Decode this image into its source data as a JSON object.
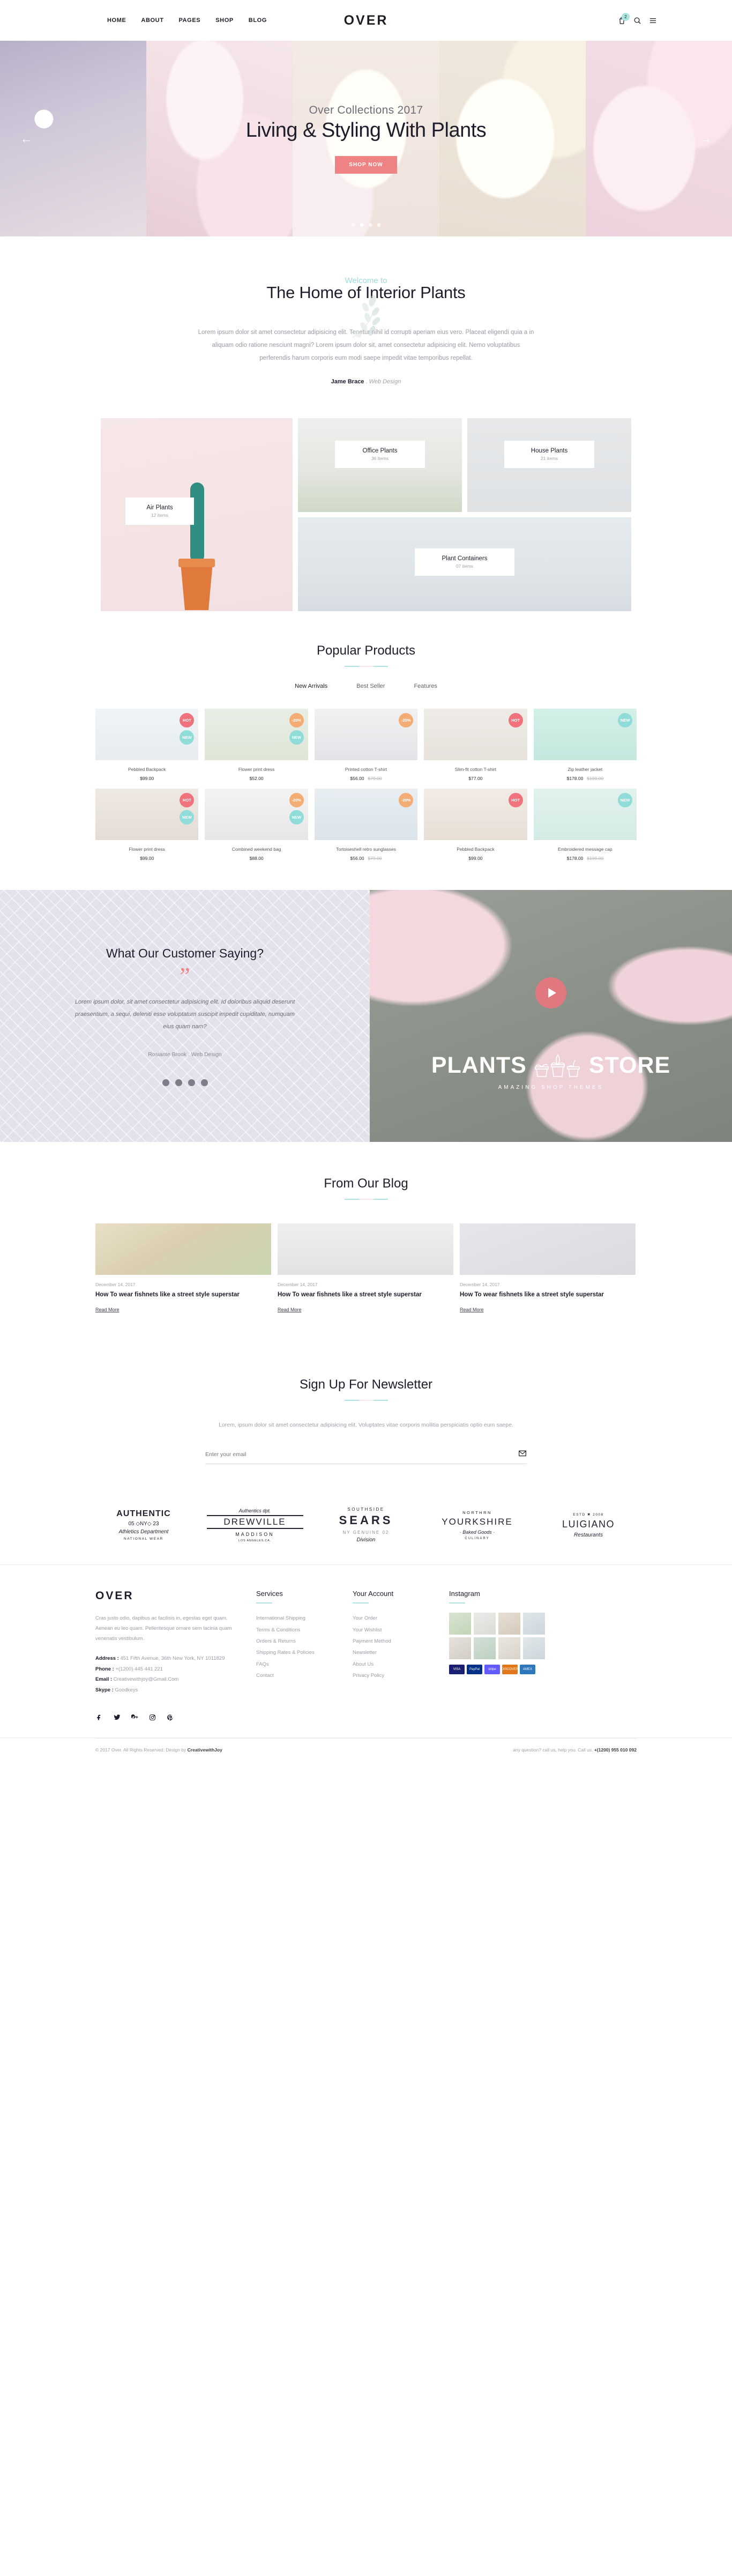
{
  "header": {
    "nav": [
      {
        "label": "HOME"
      },
      {
        "label": "ABOUT"
      },
      {
        "label": "PAGES"
      },
      {
        "label": "SHOP"
      },
      {
        "label": "BLOG"
      }
    ],
    "logo": "OVER",
    "cart_count": "2"
  },
  "hero": {
    "subtitle": "Over Collections 2017",
    "title": "Living & Styling With Plants",
    "cta": "SHOP NOW",
    "prev": "←",
    "next": "→",
    "slides": 4,
    "active_slide": 2
  },
  "intro": {
    "welcome": "Welcome to",
    "title": "The Home of Interior Plants",
    "paragraph": "Lorem ipsum dolor sit amet consectetur adipisicing elit. Tenetur nihil id corrupti aperiam eius vero. Placeat eligendi quia a in aliquam odio ratione nesciunt magni? Lorem ipsum dolor sit, amet consectetur adipisicing elit. Nemo voluptatibus perferendis harum corporis eum modi saepe impedit vitae temporibus repellat.",
    "sign_name": "Jame Brace",
    "sign_role": ". Web Design"
  },
  "categories": [
    {
      "name": "Air Plants",
      "count": "12 items"
    },
    {
      "name": "Office Plants",
      "count": "36 items"
    },
    {
      "name": "House Plants",
      "count": "21 items"
    },
    {
      "name": "Plant Containers",
      "count": "07 items"
    }
  ],
  "products": {
    "title": "Popular Products",
    "tabs": [
      {
        "label": "New Arrivals",
        "active": true
      },
      {
        "label": "Best Seller",
        "active": false
      },
      {
        "label": "Features",
        "active": false
      }
    ],
    "row1": [
      {
        "title": "Pebbled Backpack",
        "price": "$99.00",
        "old": "",
        "badges": [
          "HOT",
          "NEW"
        ]
      },
      {
        "title": "Flower print dress",
        "price": "$52.00",
        "old": "",
        "badges": [
          "-20%",
          "NEW"
        ]
      },
      {
        "title": "Printed cotton T-shirt",
        "price": "$56.00",
        "old": "$79.00",
        "badges": [
          "-20%"
        ]
      },
      {
        "title": "Slim-fit cotton T-shirt",
        "price": "$77.00",
        "old": "",
        "badges": [
          "HOT"
        ]
      },
      {
        "title": "Zip leather jacket",
        "price": "$178.00",
        "old": "$199.00",
        "badges": [
          "NEW"
        ]
      }
    ],
    "row2": [
      {
        "title": "Flower print dress",
        "price": "$99.00",
        "old": "",
        "badges": [
          "HOT",
          "NEW"
        ]
      },
      {
        "title": "Combined weekend bag",
        "price": "$88.00",
        "old": "",
        "badges": [
          "-20%",
          "NEW"
        ]
      },
      {
        "title": "Tortoiseshell retro sunglasses",
        "price": "$56.00",
        "old": "$79.00",
        "badges": [
          "-20%"
        ]
      },
      {
        "title": "Pebbled Backpack",
        "price": "$99.00",
        "old": "",
        "badges": [
          "HOT"
        ]
      },
      {
        "title": "Embroidered message cap",
        "price": "$178.00",
        "old": "$199.00",
        "badges": [
          "NEW"
        ]
      }
    ]
  },
  "testimonial": {
    "title": "What Our Customer Saying?",
    "quote_mark": "”",
    "text": "Lorem ipsum dolor, sit amet consectetur adipisicing elit. Id doloribus aliquid deserunt praesentium, a sequi, deleniti esse voluptatum suscipit impedit cupiditate, numquam eius quam nam?",
    "author": "Rosiante Brook . Web Design",
    "dots": 4
  },
  "video": {
    "brand_left": "PLANTS",
    "brand_right": "STORE",
    "tagline": "AMAZING SHOP THEMES"
  },
  "blog": {
    "title": "From Our Blog",
    "posts": [
      {
        "date": "December 14, 2017",
        "title": "How To wear fishnets like a street style superstar",
        "more": "Read More"
      },
      {
        "date": "December 14, 2017",
        "title": "How To wear fishnets like a street style superstar",
        "more": "Read More"
      },
      {
        "date": "December 14, 2017",
        "title": "How To wear fishnets like a street style superstar",
        "more": "Read More"
      }
    ]
  },
  "newsletter": {
    "title": "Sign Up For Newsletter",
    "paragraph": "Lorem, ipsum dolor sit amet consectetur adipisicing elit. Voluptates vitae corporis mollitia perspiciatis optio eum saepe.",
    "placeholder": "Enter your email"
  },
  "brands": [
    {
      "l1": "AUTHENTIC",
      "l2": "05  ◇NY◇  23",
      "l3": "Athletics Department",
      "l4": "NATIONAL WEAR"
    },
    {
      "l1": "Authentics dpt.",
      "l2": "DREWVILLE",
      "l3": "MADDISON",
      "l4": "LOS ANGELES.CA."
    },
    {
      "l1": "SOUTHSIDE",
      "l2": "SEARS",
      "l3": "NY  GENUINE  02",
      "l4": "Division"
    },
    {
      "l1": "NORTHRN",
      "l2": "YOURKSHIRE",
      "l3": "· Baked Goods ·",
      "l4": "CULINARY"
    },
    {
      "l1": "ESTD ✖ 2008",
      "l2": "LUIGIANO",
      "l3": "Restaurants",
      "l4": ""
    }
  ],
  "footer": {
    "logo": "OVER",
    "description": "Cras justo odio, dapibus ac facilisis in, egestas eget quam. Aenean eu leo quam. Pellentesque ornare sem lacinia quam venenatis vestibulum.",
    "address_label": "Address :",
    "address": "451 Fifth Avenue, 36th New York, NY 1011829",
    "phone_label": "Phone :",
    "phone": "+(1200) 445 441 221",
    "email_label": "Email :",
    "email": "Creativewithjoy@Gmail.Com",
    "skype_label": "Skype :",
    "skype": "Goodkeys",
    "services": {
      "heading": "Services",
      "items": [
        "International Shipping",
        "Terms & Conditions",
        "Orders & Returns",
        "Shipping Rates & Policies",
        "FAQs",
        "Contact"
      ]
    },
    "account": {
      "heading": "Your Account",
      "items": [
        "Your Order",
        "Your Wishlist",
        "Payment Method",
        "Newsletter",
        "About Us",
        "Privacy Policy"
      ]
    },
    "instagram": {
      "heading": "Instagram"
    },
    "payments": [
      "VISA",
      "PayPal",
      "stripe",
      "DISCOVER",
      "AMEX"
    ],
    "socials": [
      "facebook-icon",
      "twitter-icon",
      "google-plus-icon",
      "instagram-icon",
      "pinterest-icon"
    ],
    "copyright_prefix": "© 2017 Over. All Rights Reserved. Design by",
    "copyright_brand": "CreativewithJoy",
    "support": "any question? call us, help you. Call us.",
    "support_phone": "+(1200) 955 010 092"
  },
  "colors": {
    "accent_coral": "#ef8282",
    "accent_teal": "#aee4e2",
    "badge_hot": "#f0727c",
    "badge_new": "#8fdcd8",
    "badge_off": "#f3ac74",
    "text_dark": "#1d1d2b",
    "text_muted": "#9c9ca6"
  }
}
